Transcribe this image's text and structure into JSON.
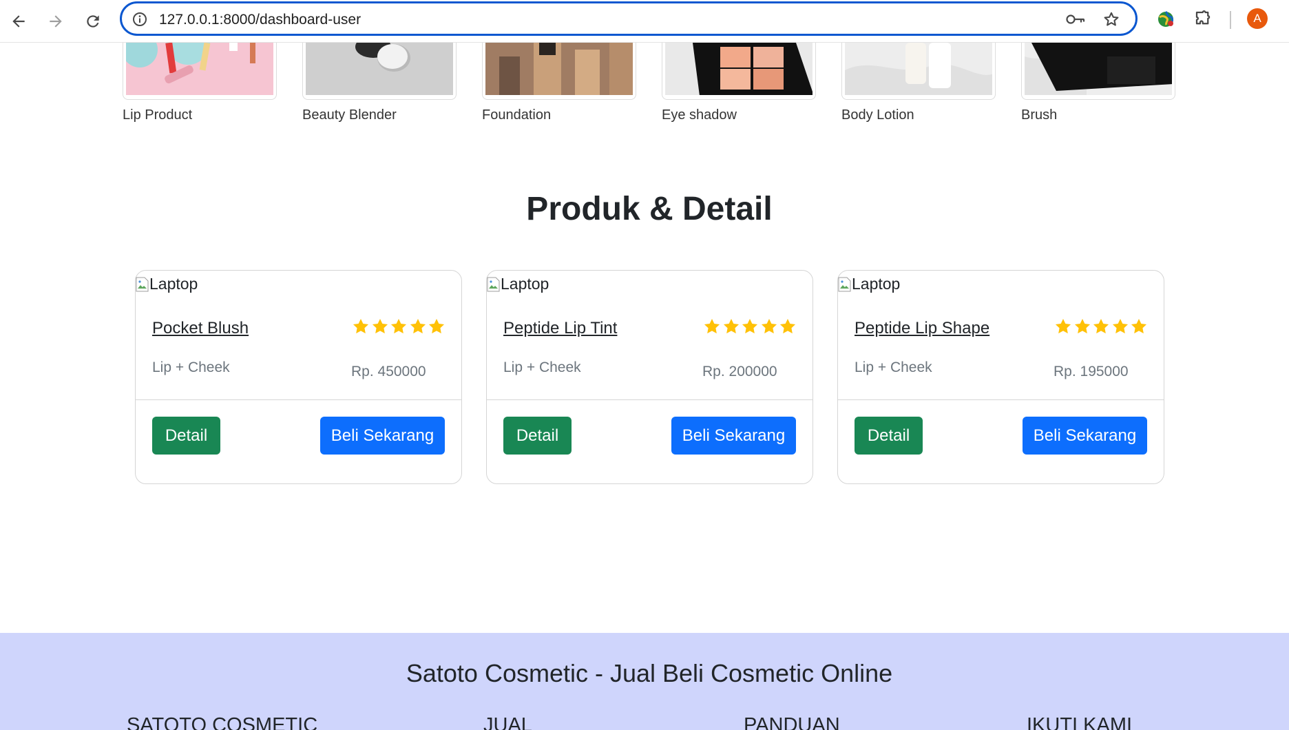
{
  "browser": {
    "url": "127.0.0.1:8000/dashboard-user",
    "profile_initial": "A"
  },
  "categories": [
    {
      "label": "Lip Product"
    },
    {
      "label": "Beauty Blender"
    },
    {
      "label": "Foundation"
    },
    {
      "label": "Eye shadow"
    },
    {
      "label": "Body Lotion"
    },
    {
      "label": "Brush"
    }
  ],
  "products_section": {
    "title": "Produk & Detail"
  },
  "products": [
    {
      "image_alt": "Laptop",
      "name": "Pocket Blush",
      "rating": 5,
      "category": "Lip + Cheek",
      "price": "Rp. 450000",
      "detail_label": "Detail",
      "buy_label": "Beli Sekarang"
    },
    {
      "image_alt": "Laptop",
      "name": "Peptide Lip Tint",
      "rating": 5,
      "category": "Lip + Cheek",
      "price": "Rp. 200000",
      "detail_label": "Detail",
      "buy_label": "Beli Sekarang"
    },
    {
      "image_alt": "Laptop",
      "name": "Peptide Lip Shape",
      "rating": 5,
      "category": "Lip + Cheek",
      "price": "Rp. 195000",
      "detail_label": "Detail",
      "buy_label": "Beli Sekarang"
    }
  ],
  "footer": {
    "title": "Satoto Cosmetic - Jual Beli Cosmetic Online",
    "columns": [
      {
        "heading": "SATOTO COSMETIC"
      },
      {
        "heading": "JUAL"
      },
      {
        "heading": "PANDUAN"
      },
      {
        "heading": "IKUTI KAMI"
      }
    ]
  },
  "colors": {
    "detail_button": "#198754",
    "buy_button": "#0d6efd",
    "star": "#ffc107",
    "footer_bg": "#cfd5fc",
    "omnibox_focus": "#0b57d0"
  }
}
